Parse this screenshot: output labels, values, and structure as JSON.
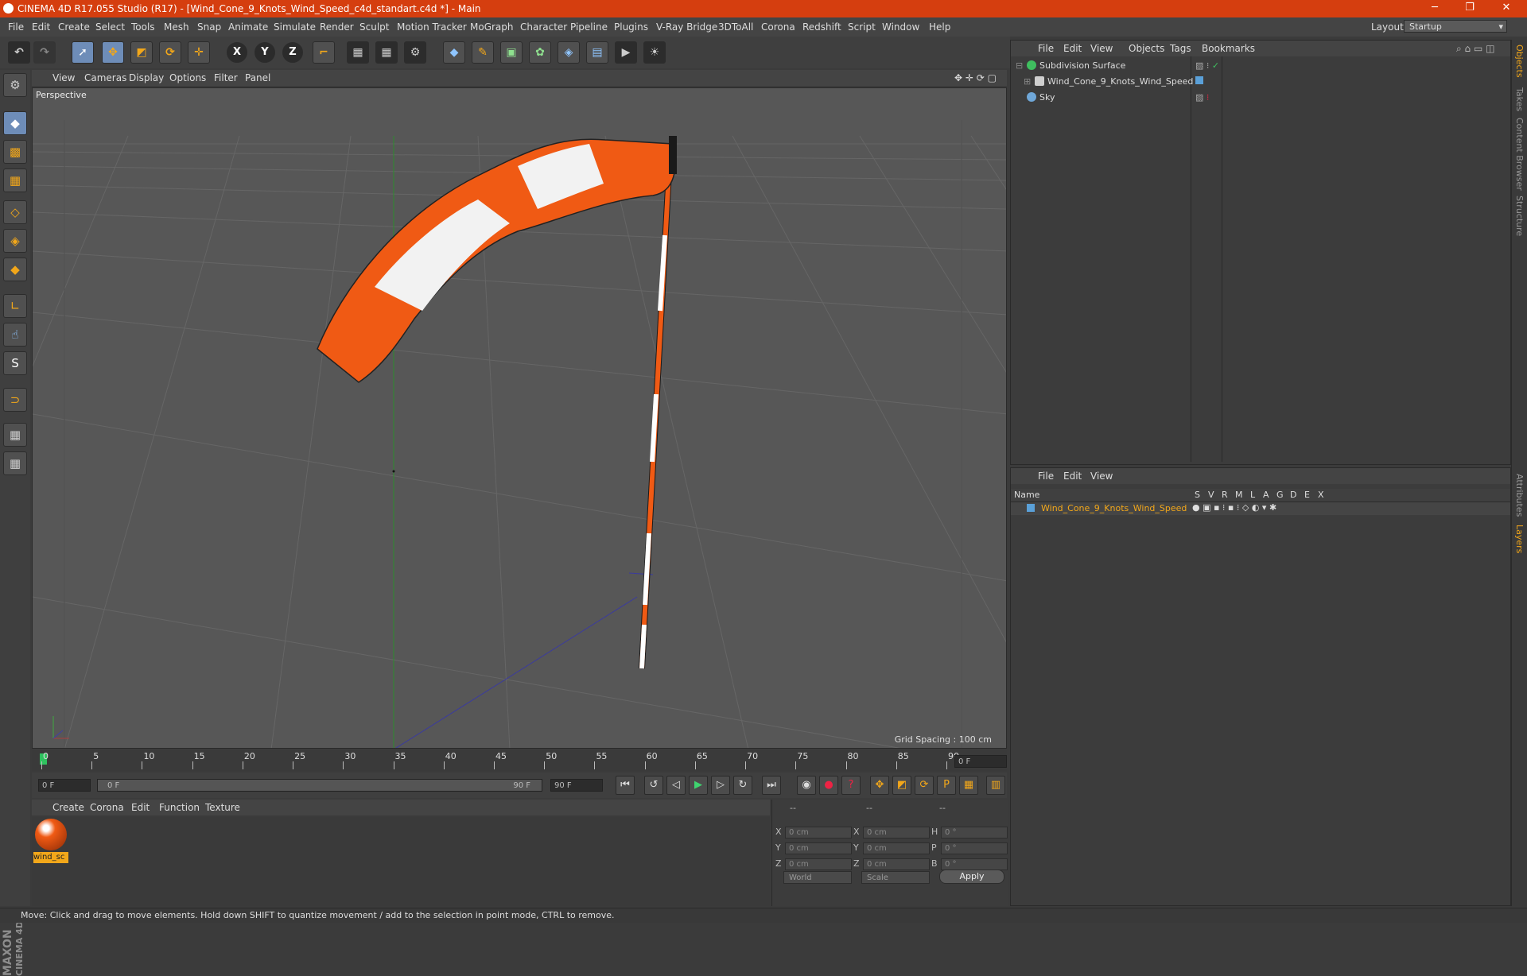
{
  "window": {
    "title": "CINEMA 4D R17.055 Studio (R17) - [Wind_Cone_9_Knots_Wind_Speed_c4d_standart.c4d *] - Main",
    "minimize": "─",
    "maximize": "❐",
    "close": "✕"
  },
  "menubar": {
    "items": [
      "File",
      "Edit",
      "Create",
      "Select",
      "Tools",
      "Mesh",
      "Snap",
      "Animate",
      "Simulate",
      "Render",
      "Sculpt",
      "Motion Tracker",
      "MoGraph",
      "Character",
      "Pipeline",
      "Plugins",
      "V-Ray Bridge",
      "3DToAll",
      "Corona",
      "Redshift",
      "Script",
      "Window",
      "Help"
    ],
    "layout_label": "Layout:",
    "layout_value": "Startup"
  },
  "toolbar": {
    "axis_x": "X",
    "axis_y": "Y",
    "axis_z": "Z"
  },
  "viewport": {
    "menu": [
      "View",
      "Cameras",
      "Display",
      "Options",
      "Filter",
      "Panel"
    ],
    "name": "Perspective",
    "grid_spacing": "Grid Spacing : 100 cm"
  },
  "timeline": {
    "ticks": [
      "0",
      "5",
      "10",
      "15",
      "20",
      "25",
      "30",
      "35",
      "40",
      "45",
      "50",
      "55",
      "60",
      "65",
      "70",
      "75",
      "80",
      "85",
      "90"
    ],
    "current_frame": "0 F",
    "start_field": "0 F",
    "range_start": "0 F",
    "range_end": "90 F",
    "end_field": "90 F"
  },
  "materials": {
    "menu": [
      "Create",
      "Corona",
      "Edit",
      "Function",
      "Texture"
    ],
    "items": [
      {
        "name": "wind_sc"
      }
    ]
  },
  "coordinates": {
    "headers": [
      "--",
      "--",
      "--"
    ],
    "rows": [
      {
        "l1": "X",
        "v1": "0 cm",
        "l2": "X",
        "v2": "0 cm",
        "l3": "H",
        "v3": "0 °"
      },
      {
        "l1": "Y",
        "v1": "0 cm",
        "l2": "Y",
        "v2": "0 cm",
        "l3": "P",
        "v3": "0 °"
      },
      {
        "l1": "Z",
        "v1": "0 cm",
        "l2": "Z",
        "v2": "0 cm",
        "l3": "B",
        "v3": "0 °"
      }
    ],
    "mode": "World",
    "transform": "Scale",
    "apply": "Apply"
  },
  "object_manager": {
    "menu": [
      "File",
      "Edit",
      "View",
      "Objects",
      "Tags",
      "Bookmarks"
    ],
    "objects": [
      {
        "name": "Subdivision Surface",
        "color": "#3fbf5f"
      },
      {
        "name": "Wind_Cone_9_Knots_Wind_Speed",
        "color": "#cfcfcf"
      },
      {
        "name": "Sky",
        "color": "#6fa7d8"
      }
    ]
  },
  "layer_manager": {
    "menu": [
      "File",
      "Edit",
      "View"
    ],
    "headers": [
      "Name",
      "S",
      "V",
      "R",
      "M",
      "L",
      "A",
      "G",
      "D",
      "E",
      "X"
    ],
    "layers": [
      {
        "name": "Wind_Cone_9_Knots_Wind_Speed",
        "color": "#5aa0d8"
      }
    ]
  },
  "right_tabs": [
    "Objects",
    "Takes",
    "Content Browser",
    "Structure",
    "Attributes",
    "Layers"
  ],
  "status": "Move: Click and drag to move elements. Hold down SHIFT to quantize movement / add to the selection in point mode, CTRL to remove.",
  "branding": {
    "maxon": "MAXON",
    "cinema": "CINEMA 4D"
  },
  "colors": {
    "accent": "#f2a71a",
    "titlebar": "#d53e0f",
    "windsock_orange": "#f05a14",
    "selection": "#6e8db8"
  }
}
